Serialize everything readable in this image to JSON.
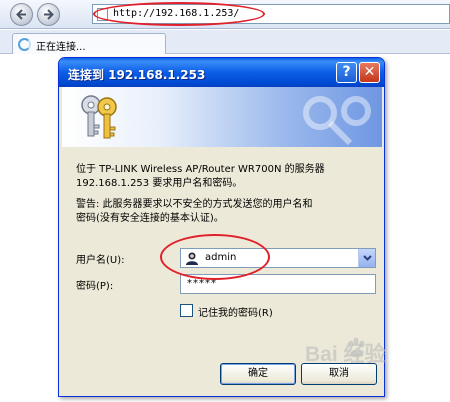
{
  "browser": {
    "url": "http://192.168.1.253/",
    "tab_title": "正在连接..."
  },
  "dialog": {
    "title": "连接到 192.168.1.253",
    "message_line1": "位于 TP-LINK Wireless AP/Router WR700N 的服务器",
    "message_line2": "192.168.1.253 要求用户名和密码。",
    "warning_line1": "警告: 此服务器要求以不安全的方式发送您的用户名和",
    "warning_line2": "密码(没有安全连接的基本认证)。",
    "username_label": "用户名(U):",
    "username_value": "admin",
    "password_label": "密码(P):",
    "password_value": "*****",
    "remember_label": "记住我的密码(R)",
    "remember_checked": false,
    "ok_label": "确定",
    "cancel_label": "取消",
    "help_glyph": "?",
    "close_glyph": "✕"
  },
  "watermark": {
    "text": "Bai 经验"
  },
  "colors": {
    "annotation": "#e0202a",
    "titlebar": "#0b5ee6",
    "dialog_bg": "#ece9d8"
  },
  "icons": [
    "back-arrow-icon",
    "forward-arrow-icon",
    "page-icon",
    "loading-spinner-icon",
    "keys-icon",
    "user-icon",
    "chevron-down-icon",
    "help-icon",
    "close-icon"
  ]
}
